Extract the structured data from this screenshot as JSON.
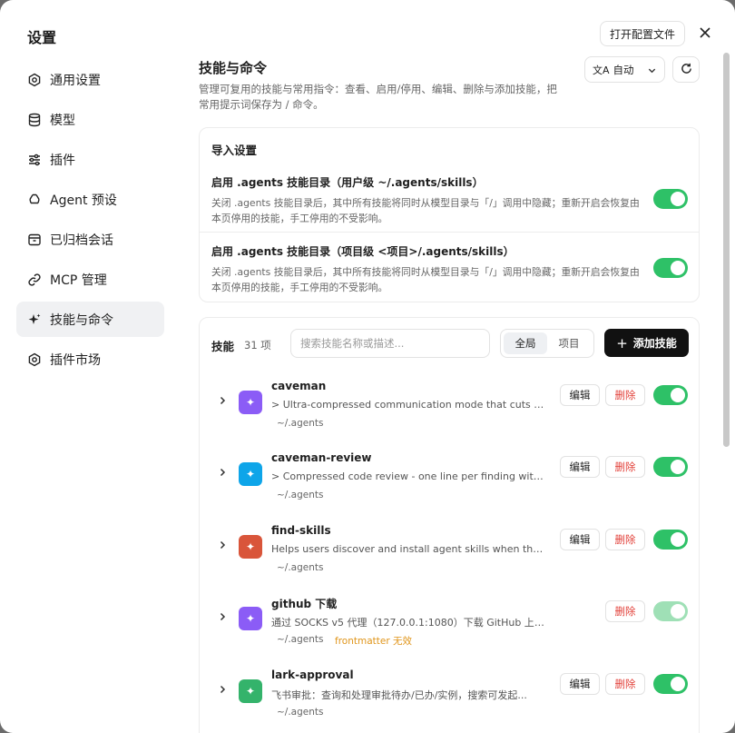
{
  "sidebar": {
    "title": "设置",
    "items": [
      {
        "label": "通用设置",
        "icon": "gear-icon",
        "active": false
      },
      {
        "label": "模型",
        "icon": "database-icon",
        "active": false
      },
      {
        "label": "插件",
        "icon": "sliders-icon",
        "active": false
      },
      {
        "label": "Agent 预设",
        "icon": "recycle-icon",
        "active": false
      },
      {
        "label": "已归档会话",
        "icon": "archive-icon",
        "active": false
      },
      {
        "label": "MCP 管理",
        "icon": "link-icon",
        "active": false
      },
      {
        "label": "技能与命令",
        "icon": "sparkle-icon",
        "active": true
      },
      {
        "label": "插件市场",
        "icon": "gear-icon",
        "active": false
      }
    ]
  },
  "header": {
    "open_config_label": "打开配置文件",
    "language_label": "自动",
    "language_icon": "translate-icon"
  },
  "main": {
    "title": "技能与命令",
    "description": "管理可复用的技能与常用指令：查看、启用/停用、编辑、删除与添加技能，把常用提示词保存为 / 命令。"
  },
  "import_settings": {
    "title": "导入设置",
    "rows": [
      {
        "title": "启用 .agents 技能目录（用户级 ~/.agents/skills）",
        "description": "关闭 .agents 技能目录后，其中所有技能将同时从模型目录与「/」调用中隐藏；重新开启会恢复由本页停用的技能，手工停用的不受影响。",
        "enabled": true
      },
      {
        "title": "启用 .agents 技能目录（项目级 <项目>/.agents/skills）",
        "description": "关闭 .agents 技能目录后，其中所有技能将同时从模型目录与「/」调用中隐藏；重新开启会恢复由本页停用的技能，手工停用的不受影响。",
        "enabled": true
      }
    ]
  },
  "skills": {
    "label": "技能",
    "count": "31 项",
    "search_placeholder": "搜索技能名称或描述...",
    "scopes": [
      "全局",
      "项目"
    ],
    "active_scope": "全局",
    "add_label": "添加技能",
    "edit_label": "编辑",
    "delete_label": "删除",
    "items": [
      {
        "name": "caveman",
        "description": "> Ultra-compressed communication mode that cuts out...",
        "path": "~/.agents",
        "color": "#8b5cf6",
        "enabled": true,
        "editable": true
      },
      {
        "name": "caveman-review",
        "description": "> Compressed code review - one line per finding with lo...",
        "path": "~/.agents",
        "color": "#0ea5e9",
        "enabled": true,
        "editable": true
      },
      {
        "name": "find-skills",
        "description": "Helps users discover and install agent skills when they a...",
        "path": "~/.agents",
        "color": "#d9553a",
        "enabled": true,
        "editable": true
      },
      {
        "name": "github 下载",
        "description": "通过 SOCKS v5 代理（127.0.0.1:1080）下载 GitHub 上的内容。触...",
        "path": "~/.agents",
        "warning": "frontmatter 无效",
        "color": "#8b5cf6",
        "enabled": true,
        "editable": false
      },
      {
        "name": "lark-approval",
        "description": "飞书审批：查询和处理审批待办/已办/实例，搜索可发起...",
        "path": "~/.agents",
        "color": "#34b36b",
        "enabled": true,
        "editable": true
      }
    ]
  }
}
